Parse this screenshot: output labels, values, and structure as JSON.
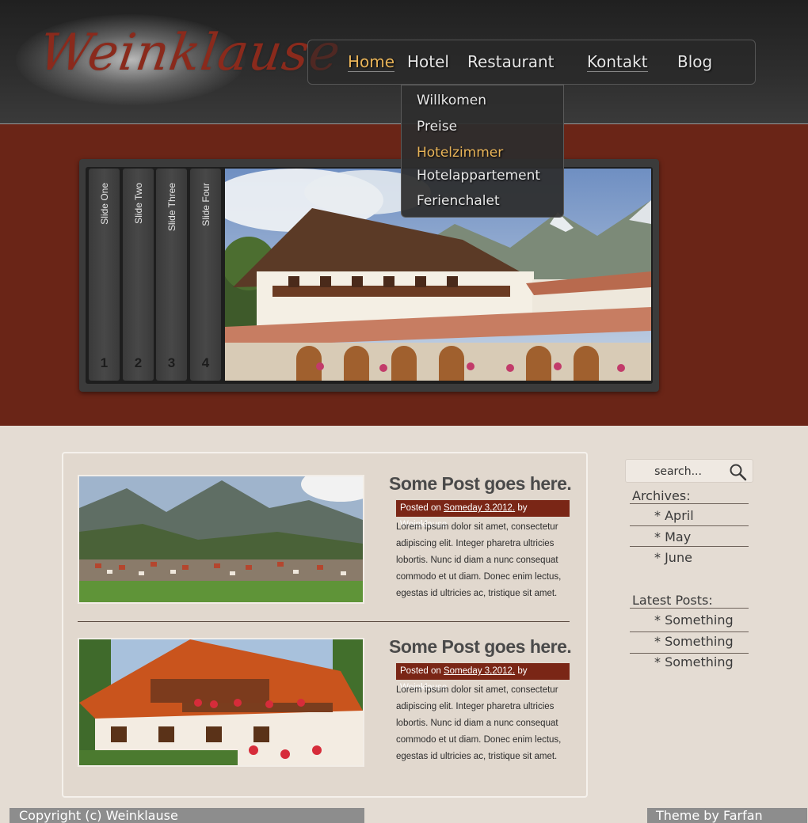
{
  "header": {
    "logo_text": "Weinklause"
  },
  "nav": {
    "items": [
      {
        "label": "Home"
      },
      {
        "label": "Hotel"
      },
      {
        "label": "Restaurant"
      },
      {
        "label": "Kontakt"
      },
      {
        "label": "Blog"
      }
    ],
    "dropdown": [
      {
        "label": "Willkomen"
      },
      {
        "label": "Preise"
      },
      {
        "label": "Hotelzimmer"
      },
      {
        "label": "Hotelappartement"
      },
      {
        "label": "Ferienchalet"
      }
    ]
  },
  "slider": {
    "tabs": [
      {
        "label": "Slide One",
        "number": "1"
      },
      {
        "label": "Slide Two",
        "number": "2"
      },
      {
        "label": "Slide Three",
        "number": "3"
      },
      {
        "label": "Slide Four",
        "number": "4"
      }
    ]
  },
  "posts": [
    {
      "title": "Some Post goes here.",
      "meta_prefix": "Posted on",
      "date": "Someday 3,2012.",
      "meta_suffix": "by Weinklause",
      "body": "Lorem ipsum dolor sit amet, consectetur adipiscing elit. Integer pharetra ultricies lobortis. Nunc id diam a nunc consequat commodo et ut diam. Donec enim lectus, egestas id ultricies ac, tristique sit amet."
    },
    {
      "title": "Some Post goes here.",
      "meta_prefix": "Posted on",
      "date": "Someday 3,2012.",
      "meta_suffix": "by Weinklause",
      "body": "Lorem ipsum dolor sit amet, consectetur adipiscing elit. Integer pharetra ultricies lobortis. Nunc id diam a nunc consequat commodo et ut diam. Donec enim lectus, egestas id ultricies ac, tristique sit amet."
    }
  ],
  "sidebar": {
    "search_placeholder": "search...",
    "archives_title": "Archives:",
    "archives": [
      "* April",
      "* May",
      "* June"
    ],
    "latest_title": "Latest Posts:",
    "latest": [
      "* Something",
      "* Something",
      "* Something"
    ]
  },
  "footer": {
    "copyright": "Copyright (c) Weinklause",
    "theme": "Theme by Farfan"
  },
  "colors": {
    "band": "#6a2517",
    "accent": "#e9b458",
    "meta_bg": "#7a2616"
  }
}
